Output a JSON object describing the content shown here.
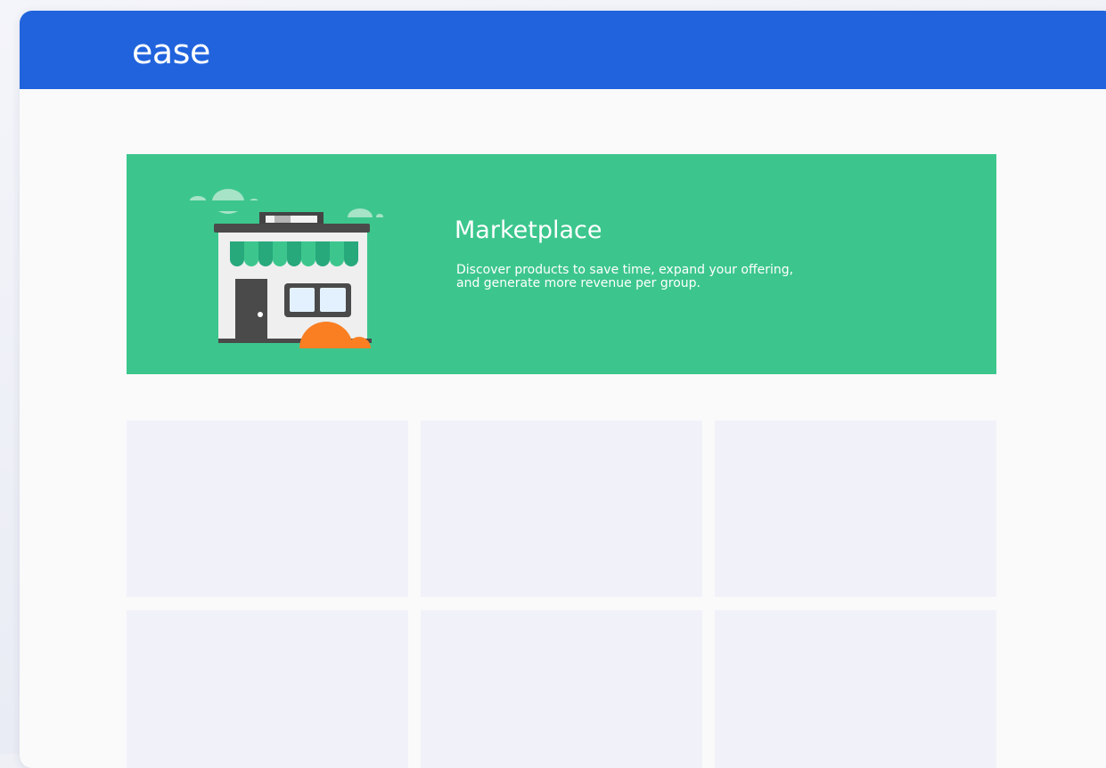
{
  "header": {
    "brand": "ease"
  },
  "banner": {
    "title": "Marketplace",
    "description_line1": "Discover products to save time, expand your offering,",
    "description_line2": "and generate more revenue per group.",
    "illustration_icon": "storefront-icon",
    "background_color": "#3cc68d"
  },
  "colors": {
    "header": "#2063dd",
    "banner": "#3cc68d",
    "card_placeholder": "#f1f2f9",
    "accent_orange": "#f97f22"
  },
  "cards": [
    {
      "state": "loading-placeholder"
    },
    {
      "state": "loading-placeholder"
    },
    {
      "state": "loading-placeholder"
    },
    {
      "state": "loading-placeholder"
    },
    {
      "state": "loading-placeholder"
    },
    {
      "state": "loading-placeholder"
    }
  ]
}
